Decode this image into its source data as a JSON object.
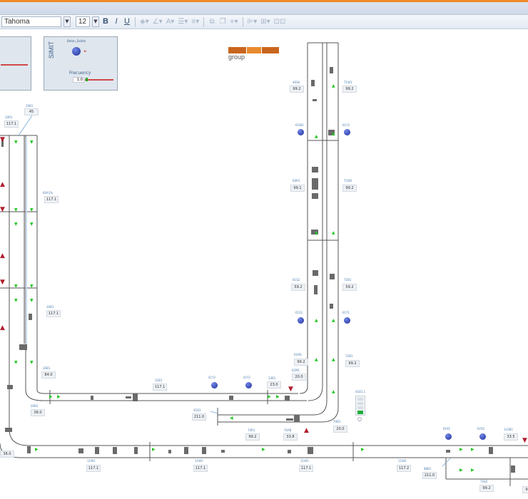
{
  "toolbar": {
    "font_name": "Tahoma",
    "font_size": "12",
    "bold_label": "B",
    "italic_label": "I",
    "underline_label": "U",
    "icons": [
      "fill-color-icon",
      "line-color-icon",
      "font-color-icon",
      "align-icon",
      "line-style-icon",
      "group-icon",
      "layer-icon",
      "align-grid-icon",
      "distribute-icon",
      "connect-icon"
    ]
  },
  "panels": {
    "simit_label": "SIMIT",
    "ball_caption": "Boton_Salida",
    "frequency_label": "Frecuency",
    "frequency_value": "1.0"
  },
  "logo": {
    "text": "group"
  },
  "indicator_label": "41B1.1",
  "colors": {
    "accent": "#f08a2a",
    "conveyor": "#555555",
    "ball": "#2a3fb5",
    "arrow": "#22c422",
    "warning": "#b02030"
  },
  "tags": [
    {
      "label": "10R1",
      "value": "117.1"
    },
    {
      "label": "10B1",
      "value": "45"
    },
    {
      "label": "60A1%",
      "value": "117.1"
    },
    {
      "label": "30B1",
      "value": "117.1"
    },
    {
      "label": "30B1",
      "value": "84.0"
    },
    {
      "label": "20B1",
      "value": "38.0"
    },
    {
      "label": "32B1",
      "value": "117.1"
    },
    {
      "label": "41B1",
      "value": "211.0"
    },
    {
      "label": "40S0",
      "value": "99.2"
    },
    {
      "label": "71W1",
      "value": "99.2"
    },
    {
      "label": "60R1",
      "value": "99.1"
    },
    {
      "label": "71W2",
      "value": "99.2"
    },
    {
      "label": "61S2",
      "value": "59.2"
    },
    {
      "label": "72B1",
      "value": "59.2"
    },
    {
      "label": "61M1",
      "value": "99.2"
    },
    {
      "label": "72B1",
      "value": "99.2"
    },
    {
      "label": "62M1",
      "value": "20.0"
    },
    {
      "label": "33B1",
      "value": "23.0"
    },
    {
      "label": "74R1",
      "value": "99.2"
    },
    {
      "label": "76A8",
      "value": "33.8"
    },
    {
      "label": "70B1",
      "value": "20.0"
    },
    {
      "label": "110B1",
      "value": "33.5"
    },
    {
      "label": "71B2",
      "value": "99.2"
    },
    {
      "label": "88B1",
      "value": "211.0"
    },
    {
      "label": "11W1",
      "value": "117.1"
    },
    {
      "label": "11W1",
      "value": "117.1"
    },
    {
      "label": "11W1",
      "value": "117.1"
    },
    {
      "label": "11W2",
      "value": "117.2"
    },
    {
      "label": "",
      "value": "36.0"
    },
    {
      "label": "",
      "value": "99.2"
    }
  ],
  "balls": [
    {
      "label": "61W2"
    },
    {
      "label": "61Y2"
    },
    {
      "label": "61S1"
    },
    {
      "label": "61Y1"
    },
    {
      "label": "41Y2"
    },
    {
      "label": "41Y2"
    },
    {
      "label": "6Y01"
    },
    {
      "label": "6Y02"
    }
  ]
}
